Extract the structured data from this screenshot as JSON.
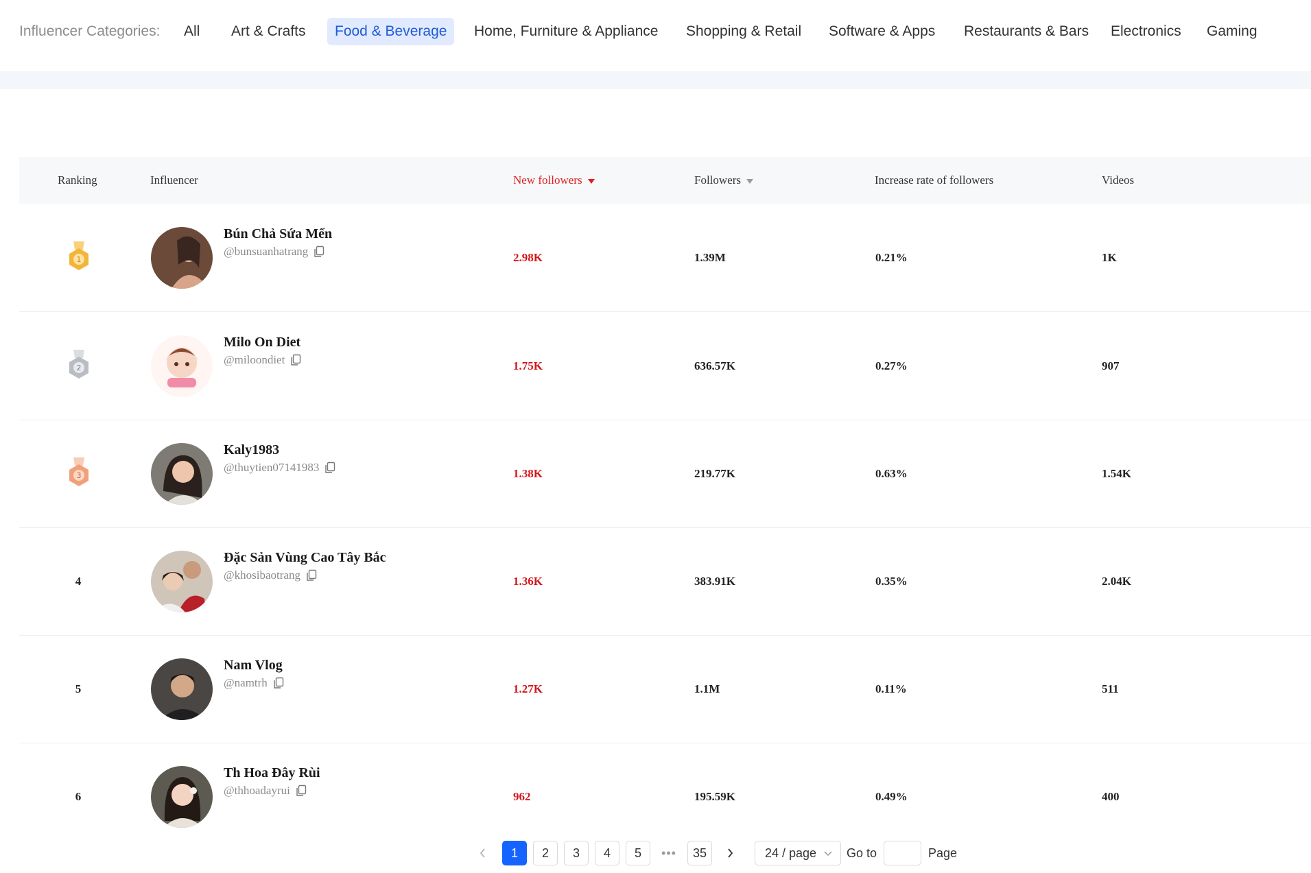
{
  "categories": {
    "title": "Influencer Categories:",
    "items": [
      {
        "label": "All",
        "active": false
      },
      {
        "label": "Art & Crafts",
        "active": false
      },
      {
        "label": "Food & Beverage",
        "active": true
      },
      {
        "label": "Home, Furniture & Appliance",
        "active": false
      },
      {
        "label": "Shopping & Retail",
        "active": false
      },
      {
        "label": "Software & Apps",
        "active": false
      },
      {
        "label": "Restaurants & Bars",
        "active": false
      },
      {
        "label": "Electronics",
        "active": false
      },
      {
        "label": "Gaming",
        "active": false
      }
    ]
  },
  "table": {
    "headers": {
      "ranking": "Ranking",
      "influencer": "Influencer",
      "new_followers": "New followers",
      "followers": "Followers",
      "increase_rate": "Increase rate of followers",
      "videos": "Videos"
    },
    "sorted_column": "new_followers",
    "rows": [
      {
        "rank": "1",
        "medal": "gold",
        "name": "Bún Chả Sứa Mến",
        "handle": "@bunsuanhatrang",
        "new_followers": "2.98K",
        "followers": "1.39M",
        "increase_rate": "0.21%",
        "videos": "1K"
      },
      {
        "rank": "2",
        "medal": "silver",
        "name": "Milo On Diet",
        "handle": "@miloondiet",
        "new_followers": "1.75K",
        "followers": "636.57K",
        "increase_rate": "0.27%",
        "videos": "907"
      },
      {
        "rank": "3",
        "medal": "bronze",
        "name": "Kaly1983",
        "handle": "@thuytien07141983",
        "new_followers": "1.38K",
        "followers": "219.77K",
        "increase_rate": "0.63%",
        "videos": "1.54K"
      },
      {
        "rank": "4",
        "medal": "",
        "name": "Đặc Sản Vùng Cao Tây Bắc",
        "handle": "@khosibaotrang",
        "new_followers": "1.36K",
        "followers": "383.91K",
        "increase_rate": "0.35%",
        "videos": "2.04K"
      },
      {
        "rank": "5",
        "medal": "",
        "name": "Nam Vlog",
        "handle": "@namtrh",
        "new_followers": "1.27K",
        "followers": "1.1M",
        "increase_rate": "0.11%",
        "videos": "511"
      },
      {
        "rank": "6",
        "medal": "",
        "name": "Th Hoa Đây Rùi",
        "handle": "@thhoadayrui",
        "new_followers": "962",
        "followers": "195.59K",
        "increase_rate": "0.49%",
        "videos": "400"
      }
    ]
  },
  "pagination": {
    "pages": [
      "1",
      "2",
      "3",
      "4",
      "5"
    ],
    "current": "1",
    "ellipsis": "•••",
    "last": "35",
    "page_size": "24 / page",
    "goto_label": "Go to",
    "page_label": "Page"
  },
  "colors": {
    "accent": "#1664ff",
    "sorted": "#e02020",
    "value_red": "#d4161b",
    "gold": "#f2b53a",
    "silver": "#b9bcc2",
    "bronze": "#f0a07a"
  }
}
